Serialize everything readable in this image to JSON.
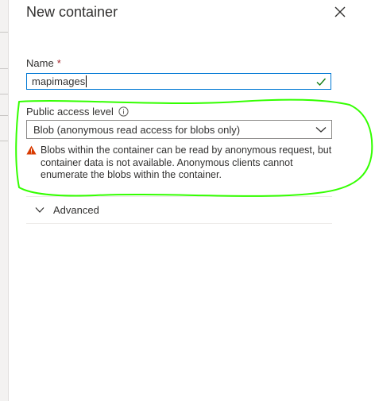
{
  "panel": {
    "title": "New container",
    "close_icon": "close-icon"
  },
  "form": {
    "name": {
      "label": "Name",
      "required_marker": "*",
      "value": "mapimages",
      "status_icon": "check-icon"
    },
    "public_access": {
      "label": "Public access level",
      "info_icon": "info-icon",
      "selected": "Blob (anonymous read access for blobs only)",
      "dropdown_icon": "chevron-down-icon"
    },
    "warning": {
      "icon": "warning-icon",
      "text": "Blobs within the container can be read by anonymous request, but container data is not available. Anonymous clients cannot enumerate the blobs within the container."
    },
    "advanced": {
      "label": "Advanced",
      "icon": "chevron-down-icon"
    }
  },
  "colors": {
    "input_focus_border": "#0078d4",
    "success_check": "#107c10",
    "warning": "#d83b01",
    "required": "#a4262c",
    "annotation_highlight": "#33ff00"
  }
}
